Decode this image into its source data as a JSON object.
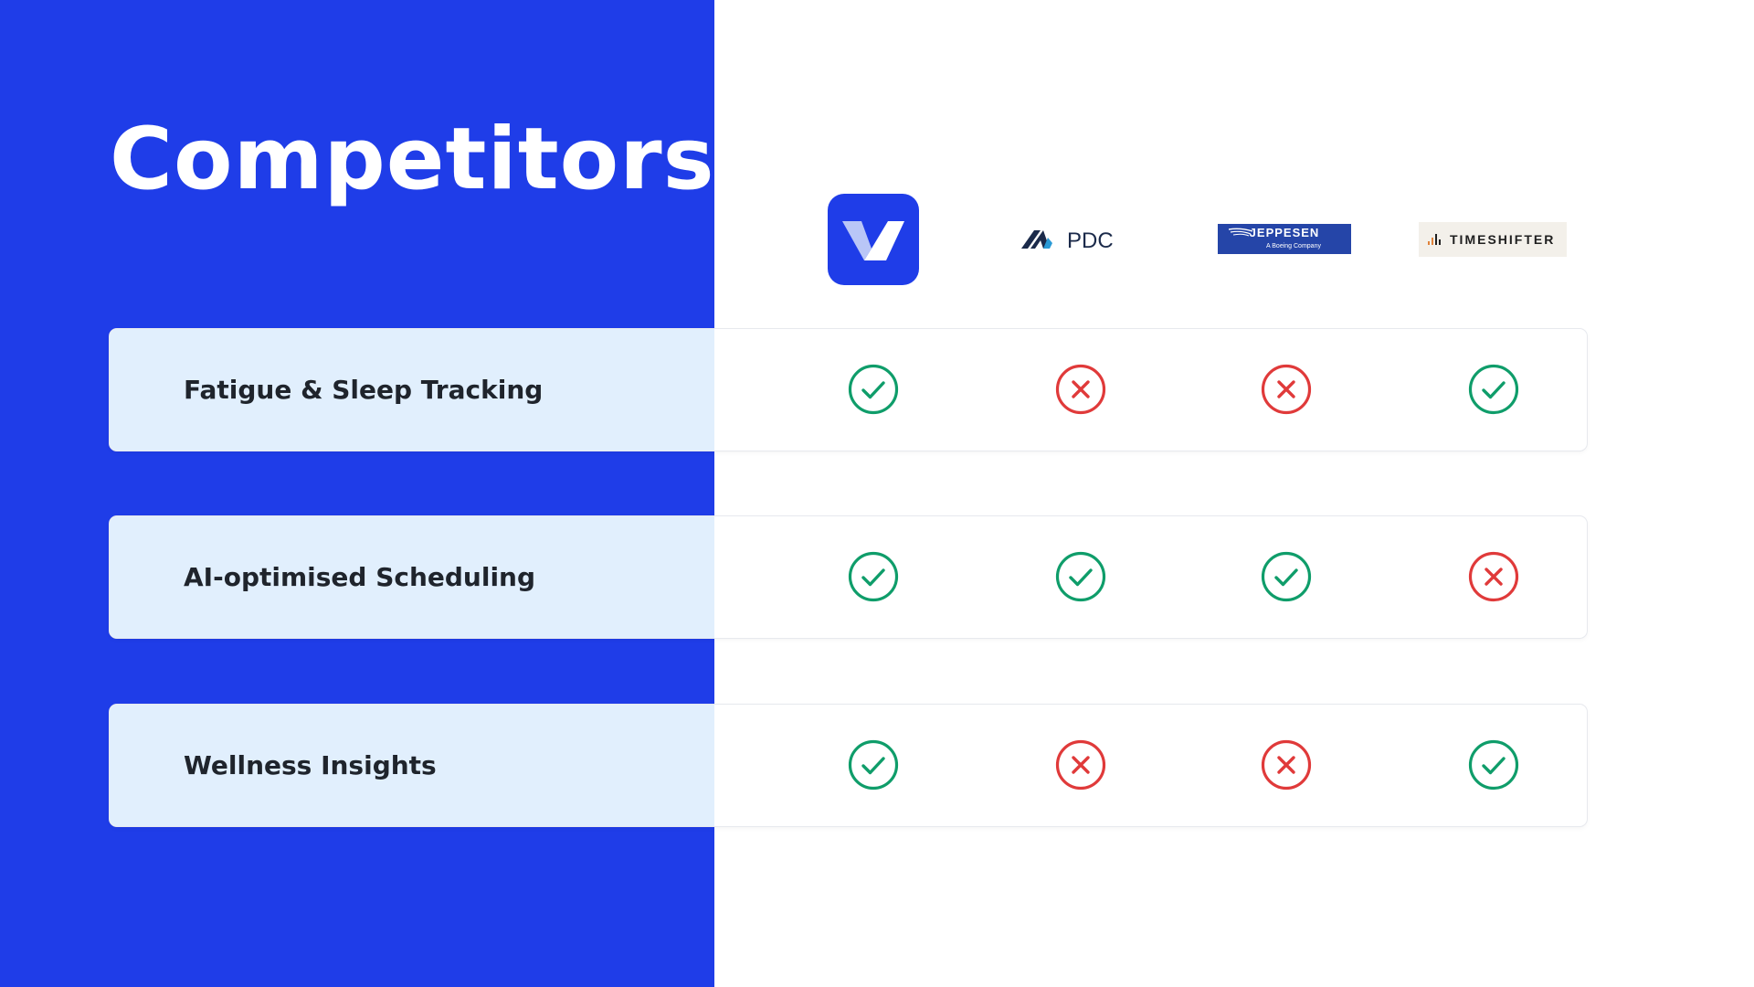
{
  "slide": {
    "title": "Competitors"
  },
  "competitors": [
    {
      "name": "own-app",
      "logo_icon": "v-checkmark-logo-icon",
      "logo_color": "#1f3de8"
    },
    {
      "name": "PDC",
      "logo_text": "PDC",
      "logo_color": "#1b2a4a"
    },
    {
      "name": "Jeppesen",
      "logo_text": "JEPPESEN",
      "logo_subtext": "A Boeing Company",
      "logo_color": "#2545a8"
    },
    {
      "name": "Timeshifter",
      "logo_text": "TIMESHIFTER",
      "logo_color": "#f3f0ea"
    }
  ],
  "features": [
    {
      "label": "Fatigue & Sleep Tracking",
      "support": [
        true,
        false,
        false,
        true
      ]
    },
    {
      "label": "AI-optimised Scheduling",
      "support": [
        true,
        true,
        true,
        false
      ]
    },
    {
      "label": "Wellness Insights",
      "support": [
        true,
        false,
        false,
        true
      ]
    }
  ],
  "icons": {
    "yes": "check-circle-icon",
    "no": "x-circle-icon"
  },
  "colors": {
    "brand_blue": "#1f3de8",
    "label_bg": "#e1effd",
    "check_green": "#0f9d6a",
    "cross_red": "#e03a3a"
  }
}
